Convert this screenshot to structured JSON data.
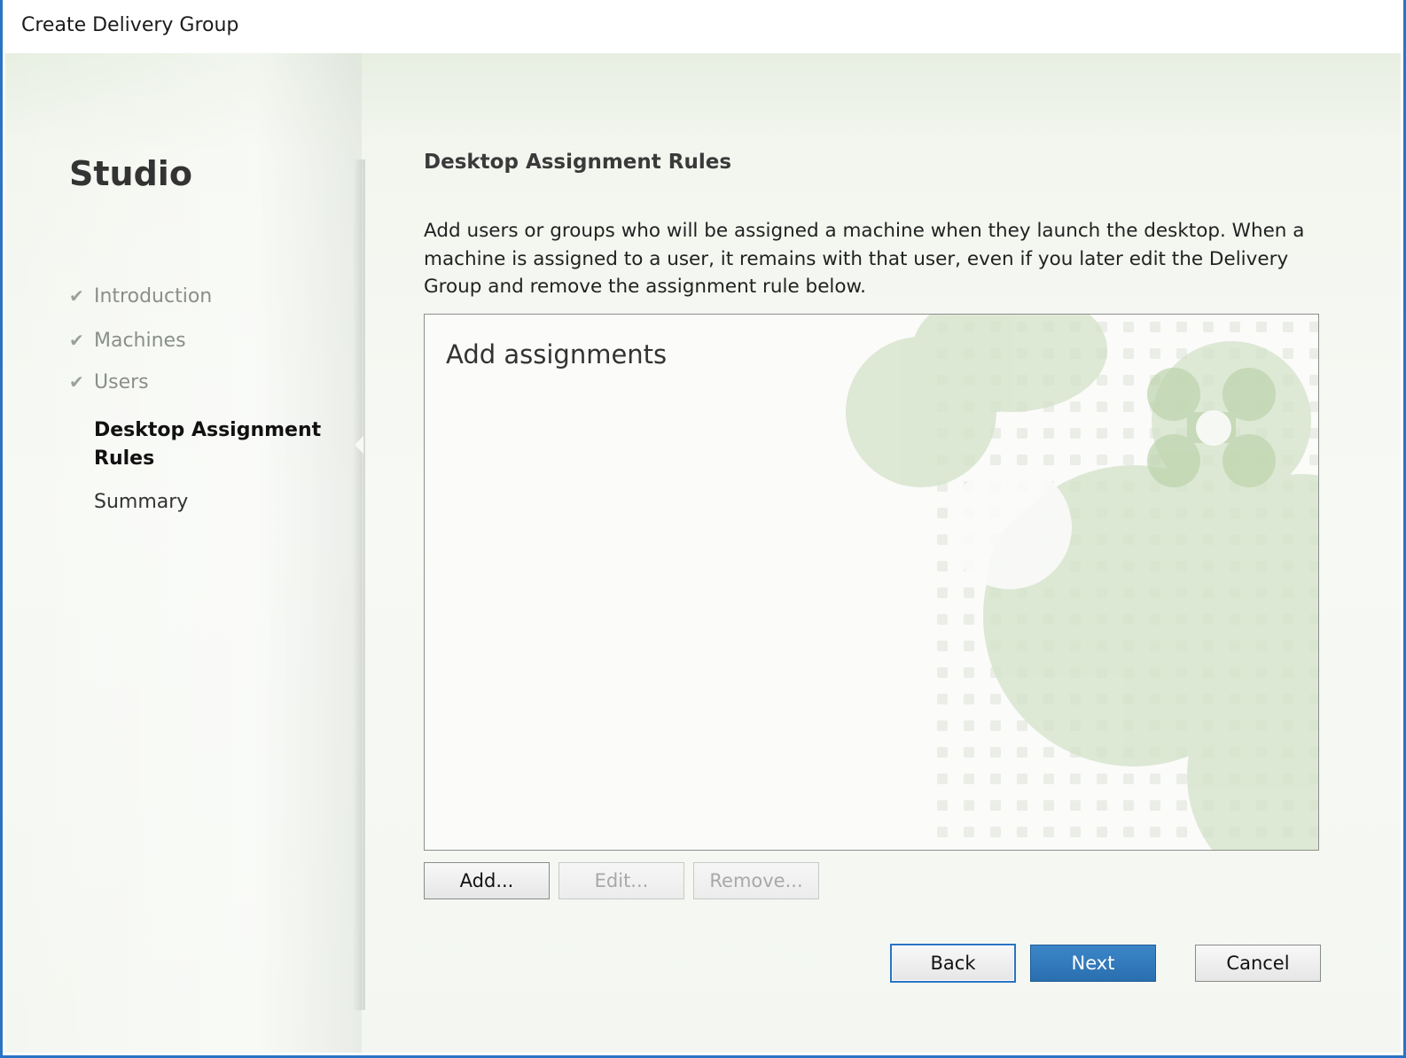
{
  "window": {
    "title": "Create Delivery Group"
  },
  "sidebar": {
    "brand": "Studio",
    "steps": [
      {
        "label": "Introduction",
        "status": "done"
      },
      {
        "label": "Machines",
        "status": "done"
      },
      {
        "label": "Users",
        "status": "done"
      },
      {
        "label": "Desktop Assignment Rules",
        "status": "current"
      },
      {
        "label": "Summary",
        "status": "pending"
      }
    ]
  },
  "main": {
    "heading": "Desktop Assignment Rules",
    "description": "Add users or groups who will be assigned a machine when they launch the desktop. When a machine is assigned to a user, it remains with that user, even if you later edit the Delivery Group and remove the assignment rule below.",
    "list_placeholder": "Add assignments",
    "buttons": {
      "add": "Add...",
      "edit": "Edit...",
      "remove": "Remove..."
    }
  },
  "footer": {
    "back": "Back",
    "next": "Next",
    "cancel": "Cancel"
  },
  "colors": {
    "accent": "#2a73c5",
    "primary_button": "#2f78bb",
    "watermark": "#c9dcbc"
  },
  "icons": {
    "done_step": "checkmark-icon"
  }
}
